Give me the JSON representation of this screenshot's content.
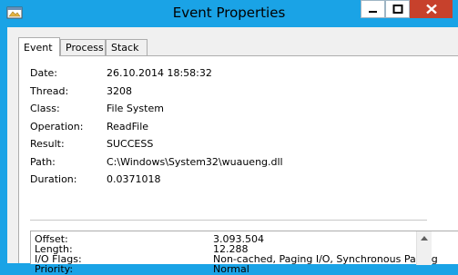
{
  "window": {
    "title": "Event Properties",
    "icon": "window-app-icon",
    "controls": [
      "minimize-icon",
      "maximize-icon",
      "close-icon"
    ]
  },
  "tabs": [
    {
      "label": "Event",
      "active": true
    },
    {
      "label": "Process",
      "active": false
    },
    {
      "label": "Stack",
      "active": false
    }
  ],
  "properties": [
    {
      "label": "Date:",
      "value": "26.10.2014 18:58:32"
    },
    {
      "label": "Thread:",
      "value": "3208"
    },
    {
      "label": "Class:",
      "value": "File System"
    },
    {
      "label": "Operation:",
      "value": "ReadFile"
    },
    {
      "label": "Result:",
      "value": "SUCCESS"
    },
    {
      "label": "Path:",
      "value": "C:\\Windows\\System32\\wuaueng.dll"
    },
    {
      "label": "Duration:",
      "value": "0.0371018"
    }
  ],
  "details": [
    {
      "label": "Offset:",
      "value": "3.093.504"
    },
    {
      "label": "Length:",
      "value": "12.288"
    },
    {
      "label": "I/O Flags:",
      "value": "Non-cached, Paging I/O, Synchronous Paging"
    },
    {
      "label": "Priority:",
      "value": "Normal"
    }
  ],
  "colors": {
    "titlebar": "#1aa3e6",
    "close_button": "#c7412c",
    "panel_background": "#ffffff",
    "dialog_background": "#f0f0f0"
  }
}
